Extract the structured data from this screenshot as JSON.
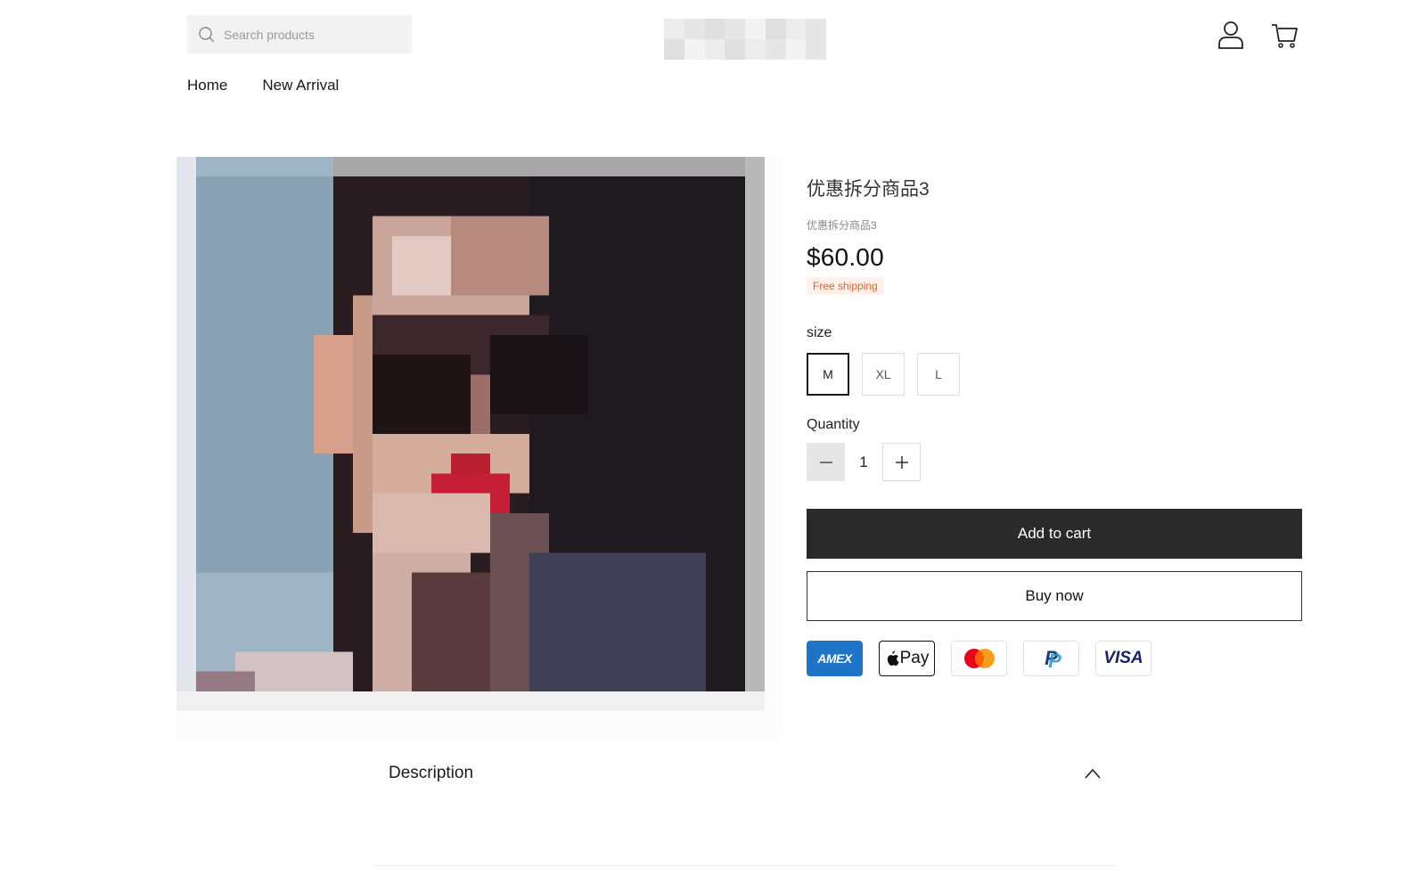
{
  "header": {
    "search": {
      "placeholder": "Search products",
      "icon": "search-icon"
    },
    "icons": [
      "account-icon",
      "cart-icon"
    ]
  },
  "nav": {
    "items": [
      {
        "label": "Home"
      },
      {
        "label": "New Arrival"
      }
    ]
  },
  "product": {
    "title": "优惠拆分商品3",
    "subtitle": "优惠拆分商品3",
    "price": "$60.00",
    "badge": "Free shipping",
    "badge_color": "#e2622d",
    "option_label": "size",
    "sizes": [
      {
        "label": "M",
        "selected": true
      },
      {
        "label": "XL",
        "selected": false
      },
      {
        "label": "L",
        "selected": false
      }
    ],
    "quantity_label": "Quantity",
    "quantity": "1",
    "add_to_cart": "Add to cart",
    "buy_now": "Buy now",
    "payments": [
      {
        "name": "amex",
        "label": "AMEX"
      },
      {
        "name": "apple-pay",
        "label": "Pay"
      },
      {
        "name": "mastercard",
        "label": ""
      },
      {
        "name": "paypal",
        "label": "P"
      },
      {
        "name": "visa",
        "label": "VISA"
      }
    ]
  },
  "description": {
    "title": "Description",
    "icon": "chevron-up-icon"
  },
  "colors": {
    "primary_button": "#2a2a2a",
    "badge_bg": "#fdf1ea"
  }
}
